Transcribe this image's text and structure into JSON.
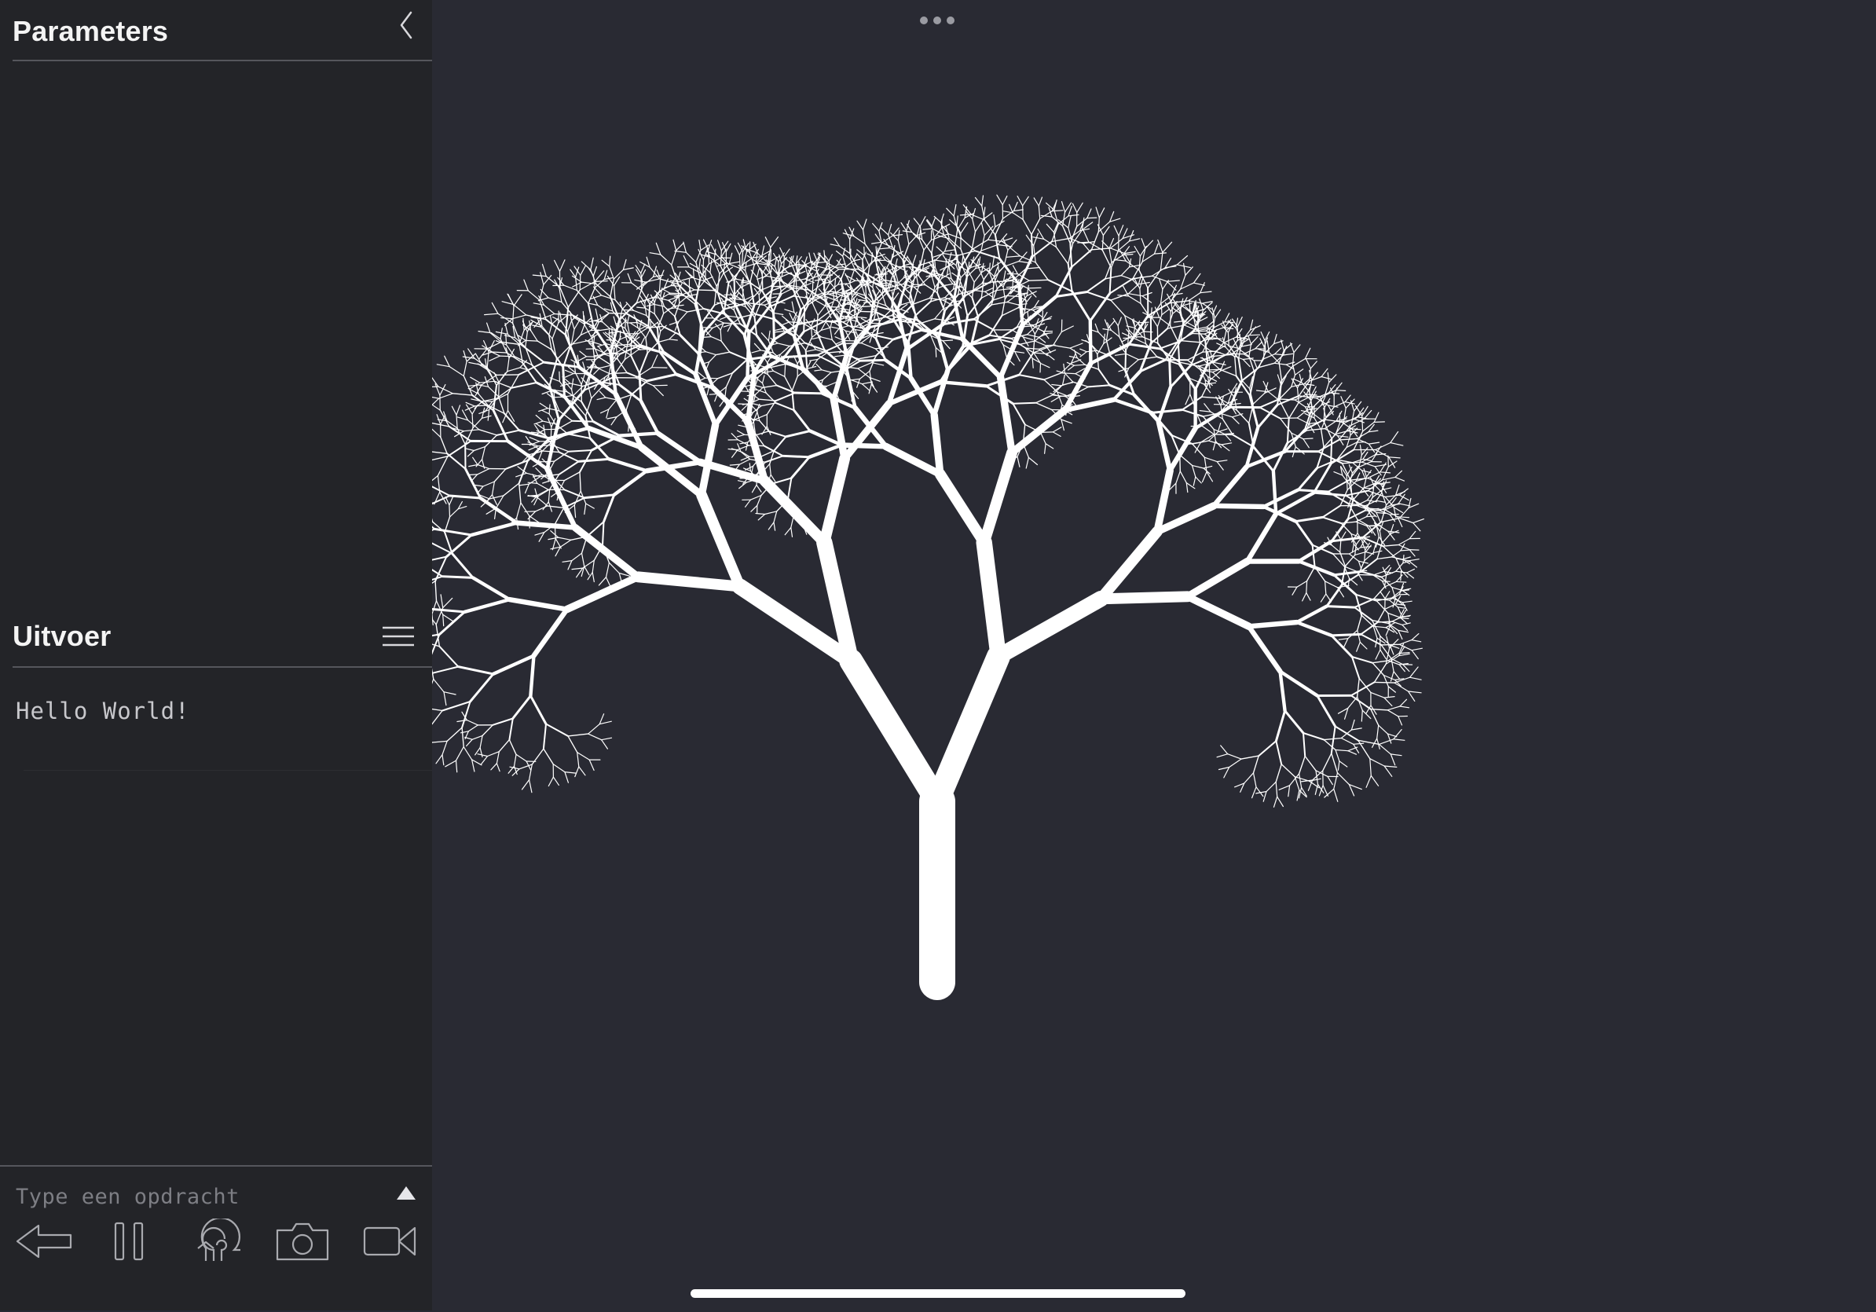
{
  "parameters": {
    "title": "Parameters"
  },
  "output": {
    "title": "Uitvoer",
    "text": "Hello World!"
  },
  "command": {
    "placeholder": "Type een opdracht"
  },
  "toolbar": {
    "buttons": [
      {
        "name": "back-button",
        "icon": "arrow-left-icon"
      },
      {
        "name": "pause-button",
        "icon": "pause-icon"
      },
      {
        "name": "restart-button",
        "icon": "restart-icon"
      },
      {
        "name": "screenshot-button",
        "icon": "camera-icon"
      },
      {
        "name": "record-button",
        "icon": "video-camera-icon"
      }
    ]
  },
  "icons": {
    "collapse": "chevron-left-icon",
    "output_menu": "hamburger-menu-icon",
    "expand": "triangle-up-icon",
    "more": "ellipsis-icon"
  },
  "canvas": {
    "content": "fractal-tree",
    "background": "#292a33",
    "stroke": "#ffffff"
  },
  "colors": {
    "sidebar": "#232428",
    "canvas": "#292a33",
    "divider": "#55565c"
  }
}
